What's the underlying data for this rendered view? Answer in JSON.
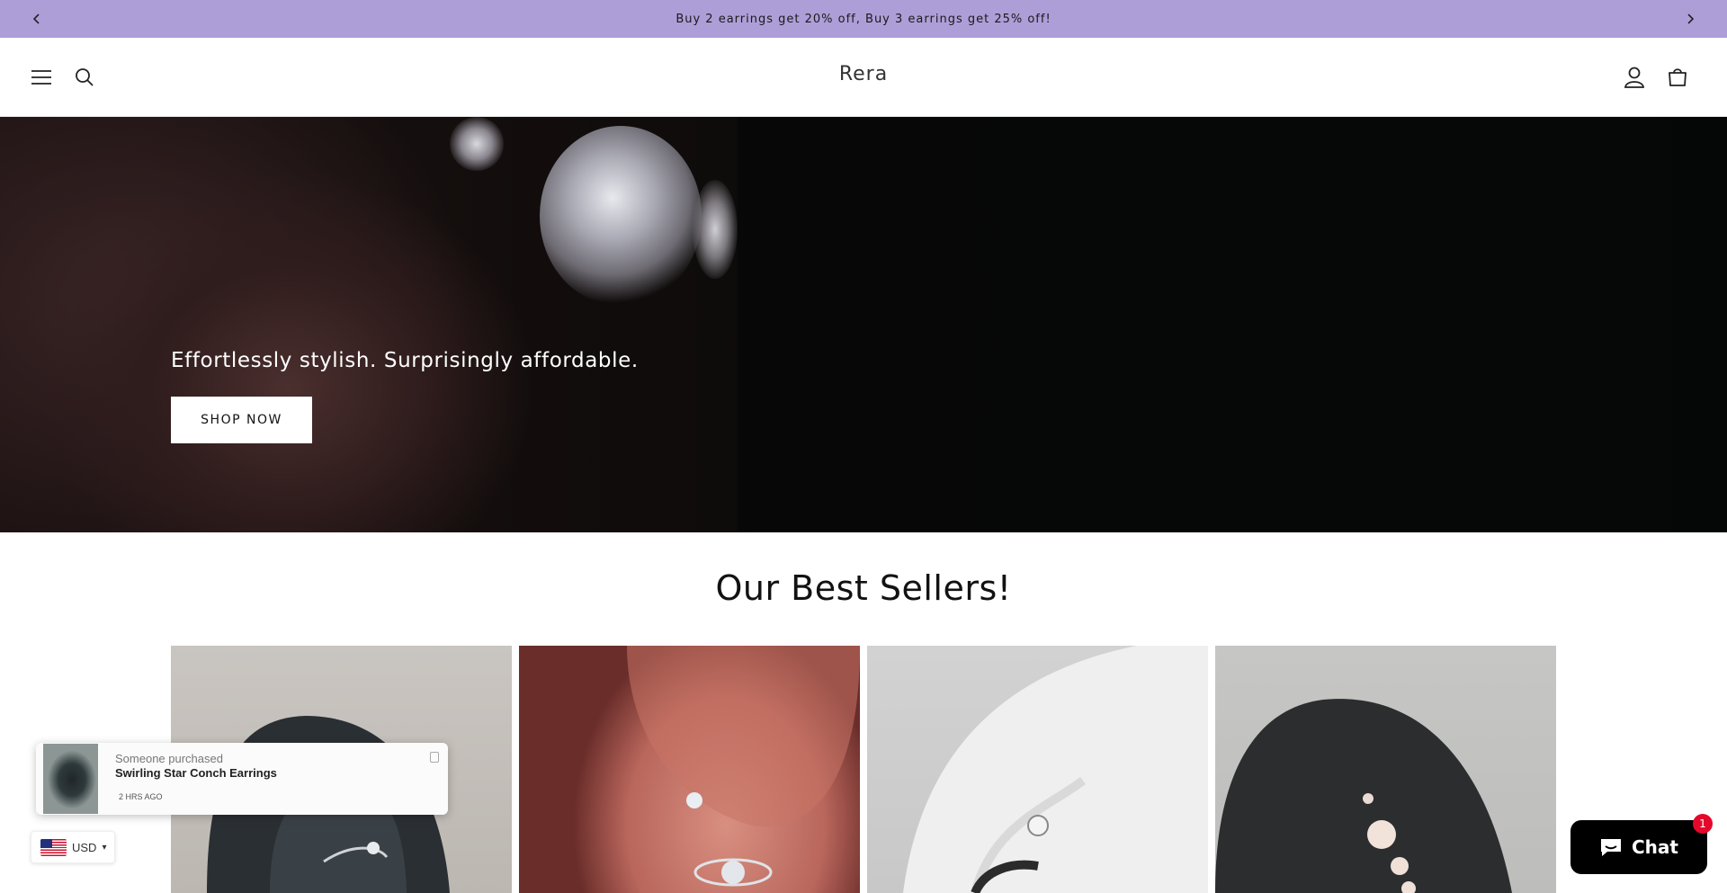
{
  "announcement": {
    "text": "Buy 2 earrings get 20% off, Buy 3 earrings get 25% off!",
    "prev_icon": "chevron-left-icon",
    "next_icon": "chevron-right-icon"
  },
  "header": {
    "logo": "Rera",
    "icons": [
      "menu-icon",
      "search-icon",
      "account-icon",
      "cart-icon"
    ]
  },
  "hero": {
    "tagline": "Effortlessly stylish. Surprisingly affordable.",
    "button_label": "SHOP NOW"
  },
  "best_sellers": {
    "title": "Our Best Sellers!"
  },
  "purchase_popup": {
    "subtitle": "Someone purchased",
    "product": "Swirling Star Conch Earrings",
    "time": "2 HRS AGO"
  },
  "currency": {
    "code": "USD"
  },
  "chat": {
    "label": "Chat",
    "badge": "1"
  },
  "colors": {
    "announcement_bg": "#ae9ed8",
    "chat_badge": "#e4082a"
  }
}
